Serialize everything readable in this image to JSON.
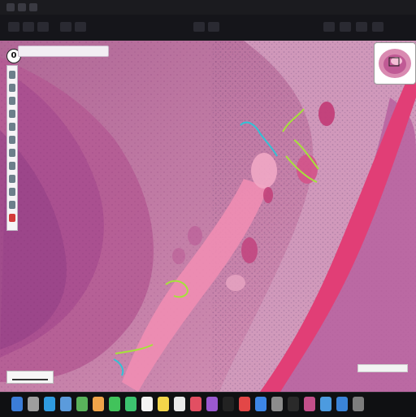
{
  "window": {
    "title": ""
  },
  "viewer": {
    "zoom_badge": "0",
    "search_placeholder": "",
    "minimap_label": "",
    "scale_label": "",
    "status_text": ""
  },
  "toolbar": {
    "buttons": [
      {
        "label": "",
        "icon": "home-icon"
      },
      {
        "label": "",
        "icon": "folder-icon"
      },
      {
        "label": "",
        "icon": "image-icon"
      },
      {
        "label": "",
        "icon": "zoom-in-icon"
      },
      {
        "label": "",
        "icon": "zoom-out-icon"
      },
      {
        "label": "",
        "icon": "ruler-icon"
      },
      {
        "label": "",
        "icon": "pen-icon"
      },
      {
        "label": "",
        "icon": "settings-icon"
      },
      {
        "label": "",
        "icon": "layers-icon"
      },
      {
        "label": "",
        "icon": "grid-icon"
      },
      {
        "label": "",
        "icon": "help-icon"
      }
    ]
  },
  "left_tools": {
    "items": [
      {
        "icon": "pointer-icon"
      },
      {
        "icon": "pan-icon"
      },
      {
        "icon": "rectangle-icon"
      },
      {
        "icon": "ellipse-icon"
      },
      {
        "icon": "polygon-icon"
      },
      {
        "icon": "freehand-icon"
      },
      {
        "icon": "brush-icon"
      },
      {
        "icon": "eraser-icon"
      },
      {
        "icon": "point-icon"
      },
      {
        "icon": "text-icon"
      },
      {
        "icon": "measure-icon"
      },
      {
        "icon": "record-icon",
        "active": true
      }
    ]
  },
  "dock": {
    "apps": [
      {
        "icon": "finder-icon",
        "color": "#3b7dd8"
      },
      {
        "icon": "launcher-icon",
        "color": "#9e9e9e"
      },
      {
        "icon": "safari-icon",
        "color": "#2f9be0"
      },
      {
        "icon": "mail-icon",
        "color": "#5b9bdc"
      },
      {
        "icon": "maps-icon",
        "color": "#59b25b"
      },
      {
        "icon": "photos-icon",
        "color": "#f0a54a"
      },
      {
        "icon": "messages-icon",
        "color": "#41c35b"
      },
      {
        "icon": "facetime-icon",
        "color": "#3cc36f"
      },
      {
        "icon": "calendar-icon",
        "color": "#f3f3f3"
      },
      {
        "icon": "notes-icon",
        "color": "#f3d54a"
      },
      {
        "icon": "reminders-icon",
        "color": "#e9e9e9"
      },
      {
        "icon": "music-icon",
        "color": "#e24f62"
      },
      {
        "icon": "podcasts-icon",
        "color": "#9b59d0"
      },
      {
        "icon": "tv-icon",
        "color": "#222"
      },
      {
        "icon": "news-icon",
        "color": "#e34747"
      },
      {
        "icon": "store-icon",
        "color": "#3d86e6"
      },
      {
        "icon": "settings-icon",
        "color": "#8c8c8c"
      },
      {
        "icon": "terminal-icon",
        "color": "#2a2a2a"
      },
      {
        "icon": "slide-viewer-icon",
        "color": "#c34f8a"
      },
      {
        "icon": "preview-icon",
        "color": "#4c9be0"
      },
      {
        "icon": "xcode-icon",
        "color": "#3a84d8"
      },
      {
        "icon": "trash-icon",
        "color": "#7d7d7d"
      }
    ]
  },
  "colors": {
    "tissue_base": "#c77a9f",
    "tissue_dark": "#8b3f7b",
    "stroma": "#e46a9b",
    "band": "#e13e76",
    "annotation_green": "#a6e23a",
    "annotation_cyan": "#32c2d6"
  }
}
